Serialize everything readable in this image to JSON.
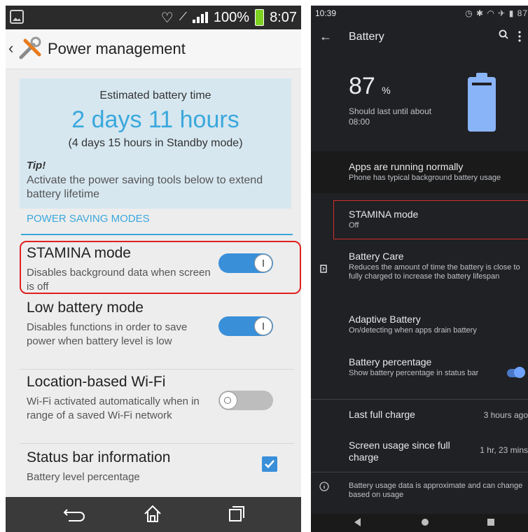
{
  "left": {
    "status": {
      "battery": "100%",
      "time": "8:07"
    },
    "title": "Power management",
    "estimate": {
      "heading": "Estimated battery time",
      "value": "2 days 11 hours",
      "standby": "(4 days 15 hours in Standby mode)",
      "tip_label": "Tip!",
      "tip_text": "Activate the power saving tools below to extend battery lifetime"
    },
    "section": "POWER SAVING MODES",
    "items": [
      {
        "title": "STAMINA mode",
        "desc": "Disables background data when screen is off",
        "state": "on"
      },
      {
        "title": "Low battery mode",
        "desc": "Disables functions in order to save power when battery level is low",
        "state": "on"
      },
      {
        "title": "Location-based Wi-Fi",
        "desc": "Wi-Fi activated automatically when in range of a saved Wi-Fi network",
        "state": "off"
      },
      {
        "title": "Status bar information",
        "desc": "Battery level percentage",
        "state": "checked"
      }
    ]
  },
  "right": {
    "status": {
      "time": "10:39",
      "battery": "87"
    },
    "title": "Battery",
    "percent": "87",
    "percent_unit": "%",
    "last_until": "Should last until about",
    "last_time": "08:00",
    "running": {
      "title": "Apps are running normally",
      "desc": "Phone has typical background battery usage"
    },
    "stamina": {
      "title": "STAMINA mode",
      "desc": "Off"
    },
    "care": {
      "title": "Battery Care",
      "desc": "Reduces the amount of time the battery is close to fully charged to increase the battery lifespan"
    },
    "adaptive": {
      "title": "Adaptive Battery",
      "desc": "On/detecting when apps drain battery"
    },
    "percentage": {
      "title": "Battery percentage",
      "desc": "Show battery percentage in status bar"
    },
    "last_full": {
      "label": "Last full charge",
      "value": "3 hours ago"
    },
    "screen_usage": {
      "label": "Screen usage since full charge",
      "value": "1 hr, 23 mins"
    },
    "footer": "Battery usage data is approximate and can change based on usage"
  },
  "colors": {
    "accent_left": "#3aa8dc",
    "toggle_on": "#3a8fd9",
    "highlight": "#e02020"
  }
}
